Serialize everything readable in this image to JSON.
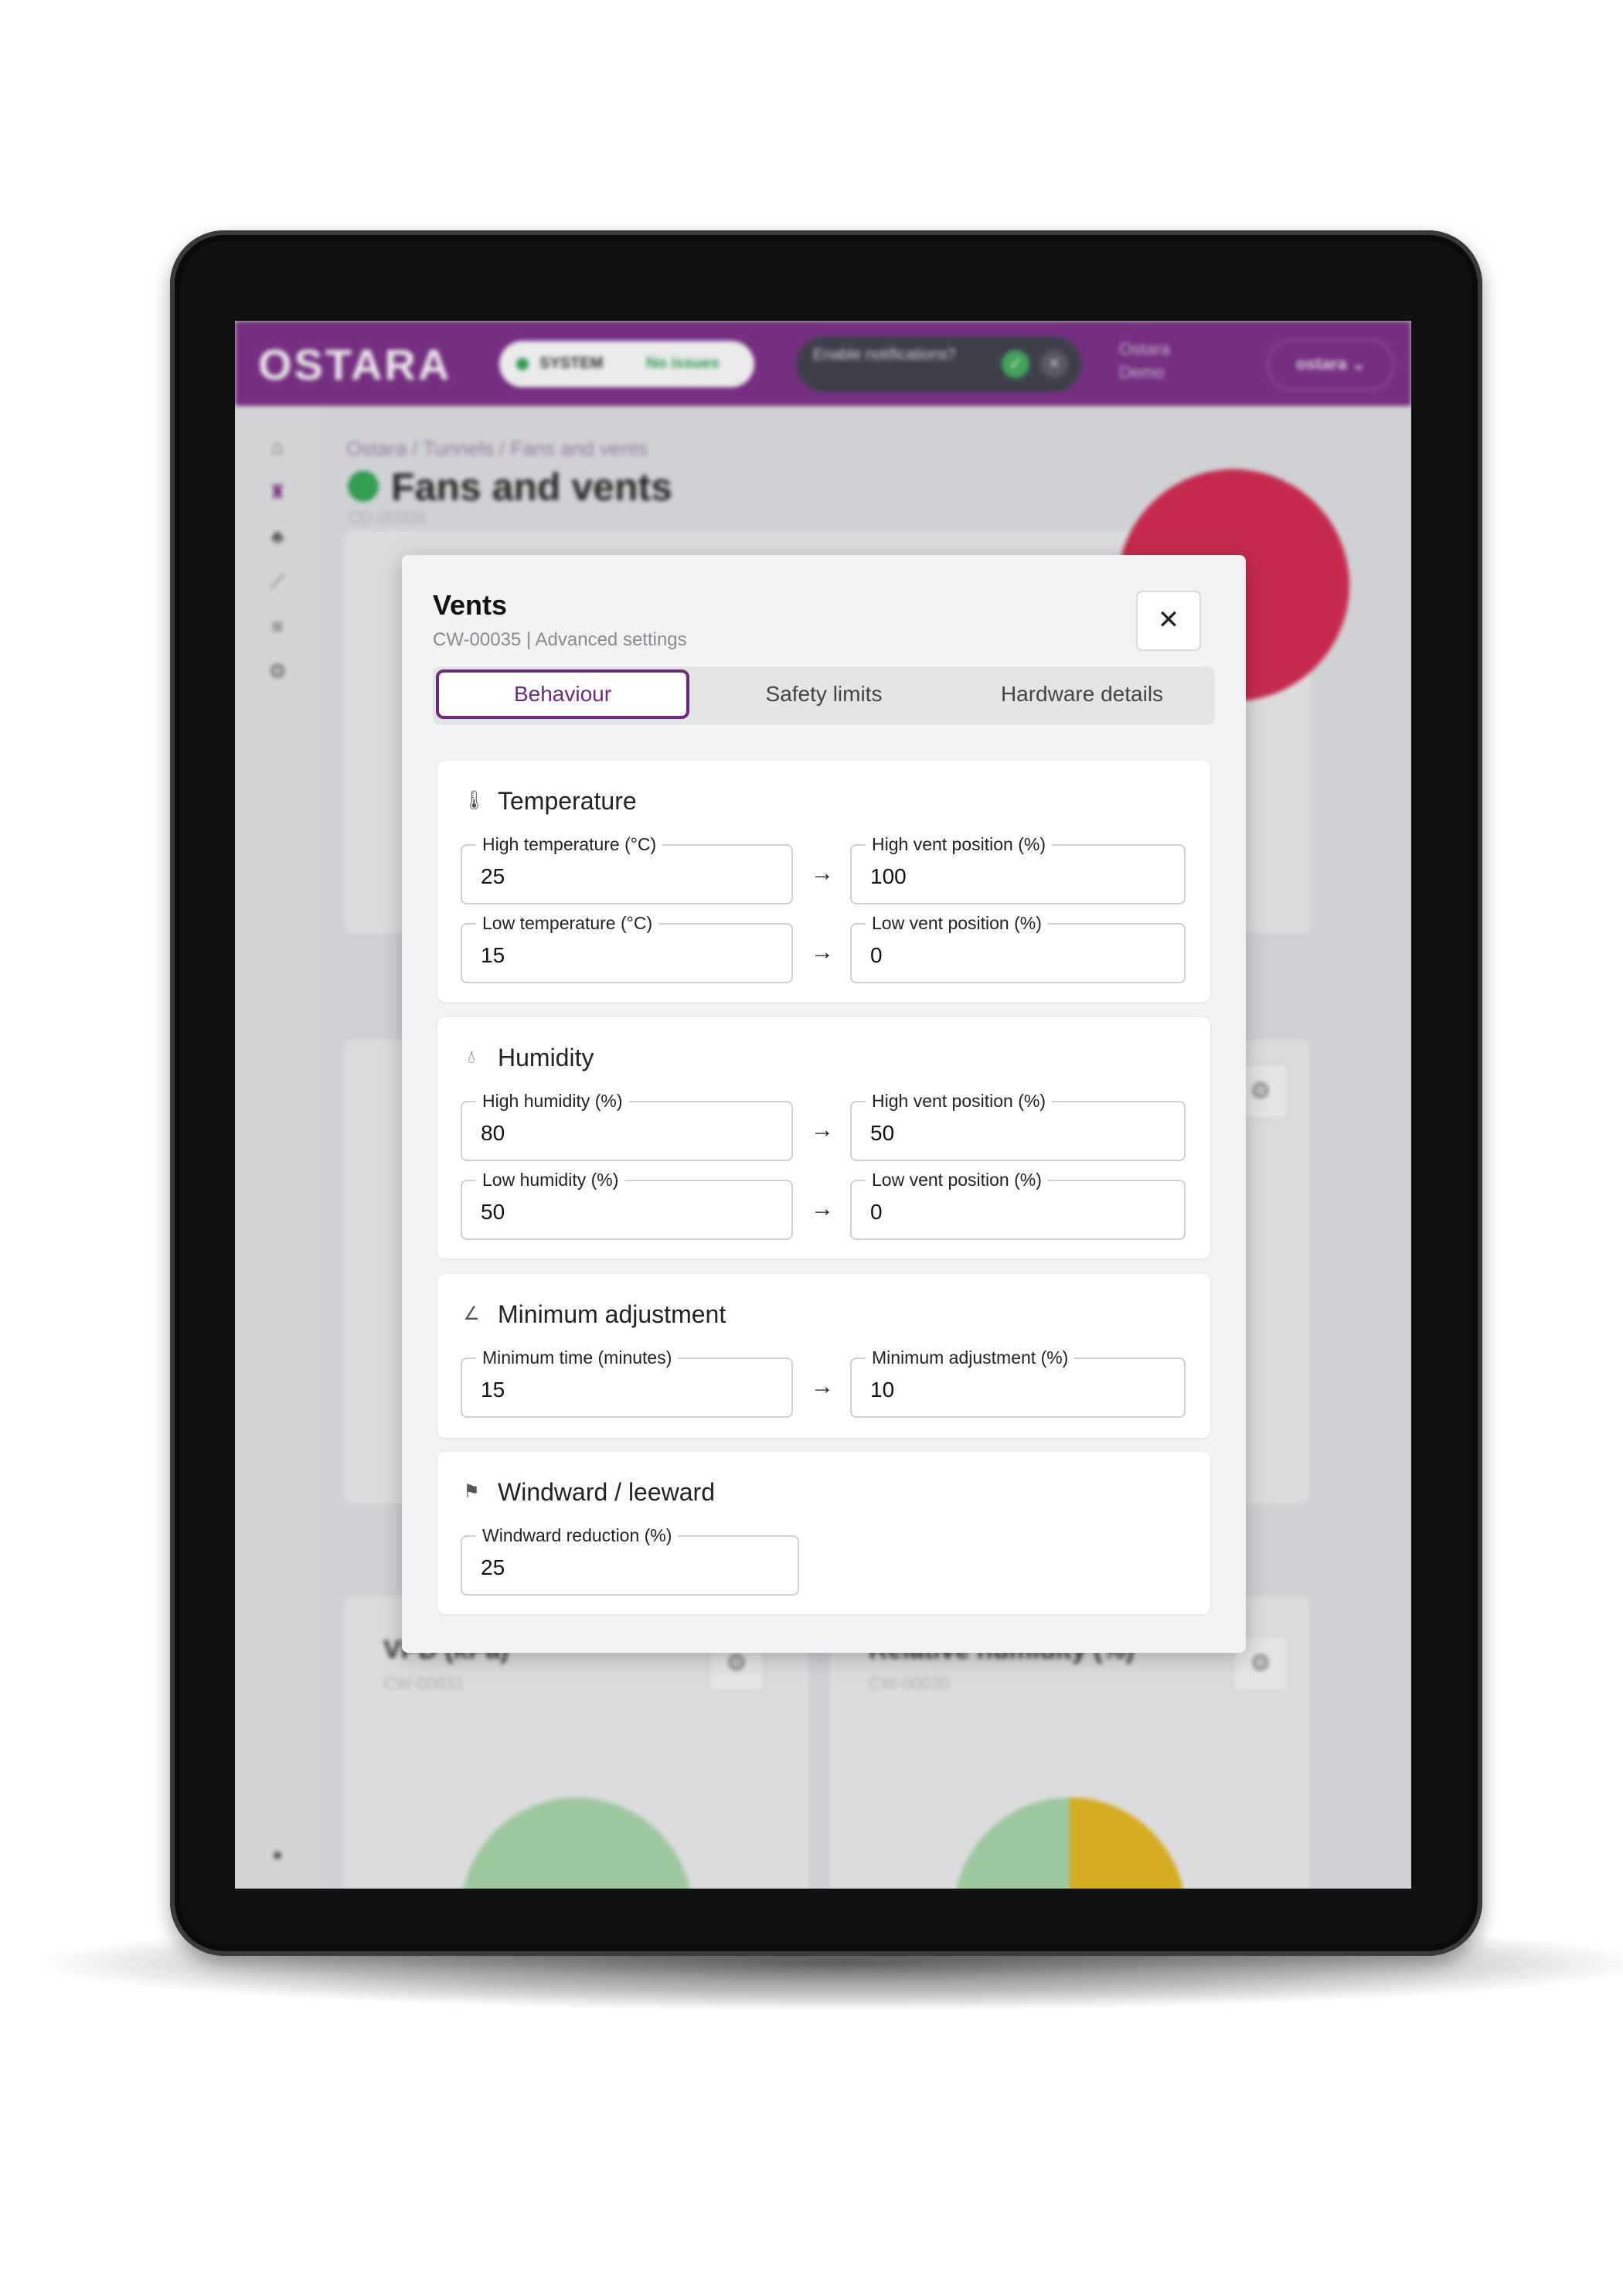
{
  "app": {
    "logo": "OSTARA",
    "system_label": "SYSTEM",
    "system_status": "No issues",
    "notification_prompt": "Enable notifications?",
    "org_name": "Ostara Demo",
    "user_name": "ostara"
  },
  "page": {
    "breadcrumb": "Ostara / Tunnels / Fans and vents",
    "title": "Fans and vents",
    "id": "CD-00009"
  },
  "background_cards": {
    "vpd_title": "VPD (kPa)",
    "vpd_id": "CW-00031",
    "rh_title": "Relative humidity (%)",
    "rh_id": "CW-00030"
  },
  "modal": {
    "title": "Vents",
    "subtitle": "CW-00035 | Advanced settings",
    "close_icon": "close-icon",
    "tabs": [
      {
        "label": "Behaviour",
        "active": true
      },
      {
        "label": "Safety limits",
        "active": false
      },
      {
        "label": "Hardware details",
        "active": false
      }
    ],
    "sections": {
      "temperature": {
        "title": "Temperature",
        "icon": "thermometer-icon",
        "high_temp_label": "High temperature (°C)",
        "high_temp_value": "25",
        "high_vent_label": "High vent position (%)",
        "high_vent_value": "100",
        "low_temp_label": "Low temperature (°C)",
        "low_temp_value": "15",
        "low_vent_label": "Low vent position (%)",
        "low_vent_value": "0"
      },
      "humidity": {
        "title": "Humidity",
        "icon": "droplet-icon",
        "high_hum_label": "High humidity (%)",
        "high_hum_value": "80",
        "high_vent_label": "High vent position (%)",
        "high_vent_value": "50",
        "low_hum_label": "Low humidity (%)",
        "low_hum_value": "50",
        "low_vent_label": "Low vent position (%)",
        "low_vent_value": "0"
      },
      "minimum_adjustment": {
        "title": "Minimum adjustment",
        "icon": "angle-icon",
        "time_label": "Minimum time (minutes)",
        "time_value": "15",
        "adj_label": "Minimum adjustment (%)",
        "adj_value": "10"
      },
      "windward": {
        "title": "Windward / leeward",
        "icon": "windsock-icon",
        "reduction_label": "Windward reduction (%)",
        "reduction_value": "25"
      }
    }
  },
  "colors": {
    "brand": "#7a2a86",
    "accent": "#6b2a7a",
    "status_ok": "#2fa84f",
    "gauge_red": "#d7264d"
  }
}
